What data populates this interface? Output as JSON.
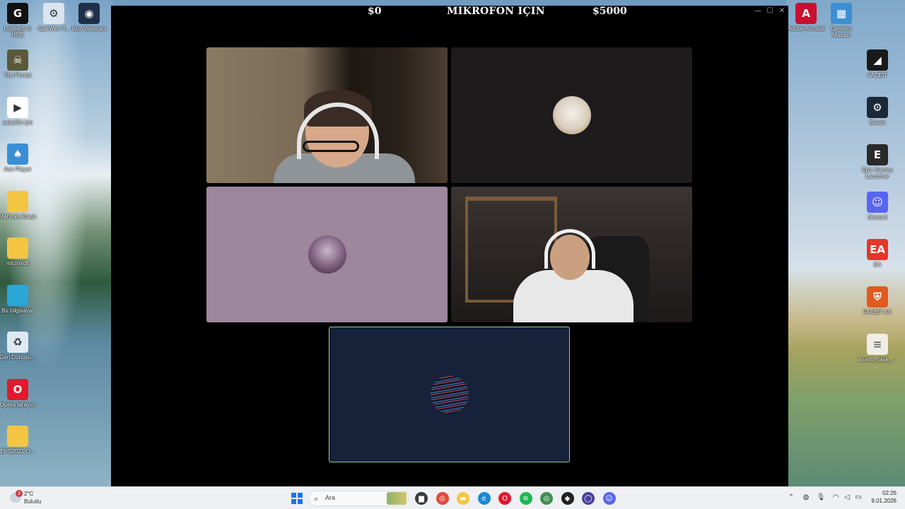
{
  "window": {
    "amount_left": "$0",
    "title": "MIKROFON IÇIN",
    "amount_right": "$5000"
  },
  "desktop_left": [
    {
      "label": "Logitech G HUB",
      "icon": "logitech-g-icon",
      "color": "#111111",
      "glyph": "G"
    },
    {
      "label": "SplitWire-T...",
      "icon": "splitwire-icon",
      "color": "#d9e4ee",
      "glyph": "⚙"
    },
    {
      "label": "Iriun Webcam",
      "icon": "iriun-webcam-icon",
      "color": "#1f2f4a",
      "glyph": "◉"
    },
    {
      "label": "The Forest",
      "icon": "the-forest-icon",
      "color": "#5a5a3a",
      "glyph": "☠"
    },
    {
      "label": "astralith için",
      "icon": "astralith-video-icon",
      "color": "#ffffff",
      "glyph": "▶"
    },
    {
      "label": "Ace Player",
      "icon": "ace-player-icon",
      "color": "#3a8fd4",
      "glyph": "♠"
    },
    {
      "label": "Mehmet Abaylı",
      "icon": "folder-icon",
      "color": "#f4c542",
      "glyph": ""
    },
    {
      "label": "microsoft",
      "icon": "folder-icon",
      "color": "#f4c542",
      "glyph": ""
    },
    {
      "label": "Bu bilgisayar",
      "icon": "this-pc-icon",
      "color": "#2aa7d6",
      "glyph": ""
    },
    {
      "label": "Geri Dönüşü...",
      "icon": "recycle-bin-icon",
      "color": "#dfe9f2",
      "glyph": "♻"
    },
    {
      "label": "Opera tarayıcı",
      "icon": "opera-icon",
      "color": "#e3182d",
      "glyph": "O"
    },
    {
      "label": "EPS2021-O...",
      "icon": "folder-icon",
      "color": "#f4c542",
      "glyph": ""
    }
  ],
  "desktop_right_top": [
    {
      "label": "Adobe Acrobat",
      "icon": "adobe-acrobat-icon",
      "color": "#c8102e",
      "glyph": "A"
    },
    {
      "label": "Denetim Masası",
      "icon": "control-panel-icon",
      "color": "#3d8fd1",
      "glyph": "▦"
    }
  ],
  "desktop_right": [
    {
      "label": "FACEIT",
      "icon": "faceit-icon",
      "color": "#1a1a1a",
      "glyph": "◢"
    },
    {
      "label": "Steam",
      "icon": "steam-icon",
      "color": "#1b2838",
      "glyph": "⚙"
    },
    {
      "label": "Epic Games Launcher",
      "icon": "epic-games-icon",
      "color": "#2a2a2a",
      "glyph": "E"
    },
    {
      "label": "Discord",
      "icon": "discord-icon",
      "color": "#5865f2",
      "glyph": "☺"
    },
    {
      "label": "EA",
      "icon": "ea-icon",
      "color": "#e4362a",
      "glyph": "EA"
    },
    {
      "label": "FACEIT AC",
      "icon": "faceit-ac-icon",
      "color": "#e05a1f",
      "glyph": "⛨"
    },
    {
      "label": "assets_task_...",
      "icon": "file-icon",
      "color": "#f0ede6",
      "glyph": "≡"
    }
  ],
  "taskbar": {
    "weather_temp": "2°C",
    "weather_cond": "Bulutlu",
    "weather_badge": "3",
    "search_placeholder": "Ara",
    "time": "02:26",
    "date": "9.01.2026"
  },
  "taskbar_apps": [
    {
      "icon": "file-explorer-icon",
      "color": "#3b3b3b",
      "glyph": "▆"
    },
    {
      "icon": "chrome-icon",
      "color": "#e24a3b",
      "glyph": "◎"
    },
    {
      "icon": "folder-icon",
      "color": "#f4c542",
      "glyph": "▬"
    },
    {
      "icon": "edge-icon",
      "color": "#1b8ad6",
      "glyph": "e"
    },
    {
      "icon": "opera-icon",
      "color": "#e3182d",
      "glyph": "O"
    },
    {
      "icon": "spotify-icon",
      "color": "#1db954",
      "glyph": "≋"
    },
    {
      "icon": "chrome-profile-icon",
      "color": "#3f8f4f",
      "glyph": "◎"
    },
    {
      "icon": "github-icon",
      "color": "#222222",
      "glyph": "◆"
    },
    {
      "icon": "app-icon",
      "color": "#4b3f9e",
      "glyph": "◯"
    },
    {
      "icon": "discord-icon",
      "color": "#5865f2",
      "glyph": "☺"
    }
  ],
  "colors": {
    "window_bg": "#000000",
    "active_speaker_border": "#8fd08a",
    "tile_dark": "#1e1b1c",
    "tile_mauve": "#9c879c",
    "tile_navy": "#16213a"
  }
}
